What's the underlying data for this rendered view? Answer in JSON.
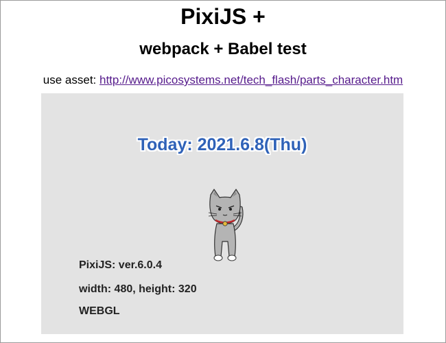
{
  "header": {
    "title": "PixiJS +",
    "subtitle": "webpack + Babel test"
  },
  "asset": {
    "label": "use asset: ",
    "link_text": "http://www.picosystems.net/tech_flash/parts_character.htm"
  },
  "canvas": {
    "today_text": "Today: 2021.6.8(Thu)",
    "version_text": "PixiJS: ver.6.0.4",
    "size_text": "width: 480, height: 320",
    "renderer_text": "WEBGL",
    "character": "cat-character"
  },
  "colors": {
    "canvas_bg": "#e3e3e3",
    "today_text": "#2f62b8",
    "link": "#551a8b"
  }
}
